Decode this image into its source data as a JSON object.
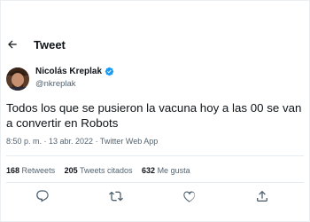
{
  "header": {
    "title": "Tweet",
    "back_icon": "arrow-left-icon"
  },
  "author": {
    "name": "Nicolás Kreplak",
    "handle": "@nkreplak",
    "verified_icon": "verified-badge-icon",
    "verified_color": "#1d9bf0"
  },
  "tweet": {
    "text": "Todos los que se pusieron la vacuna hoy a las 00 se van a convertir en Robots",
    "timestamp": "8:50 p. m. · 13 abr. 2022 · Twitter Web App"
  },
  "stats": {
    "retweets_count": "168",
    "retweets_label": "Retweets",
    "quotes_count": "205",
    "quotes_label": "Tweets citados",
    "likes_count": "632",
    "likes_label": "Me gusta"
  },
  "actions": {
    "reply_icon": "reply-icon",
    "retweet_icon": "retweet-icon",
    "like_icon": "heart-icon",
    "share_icon": "share-icon"
  },
  "colors": {
    "text_primary": "#0f1419",
    "text_secondary": "#536471",
    "divider": "#e6ecf0"
  }
}
